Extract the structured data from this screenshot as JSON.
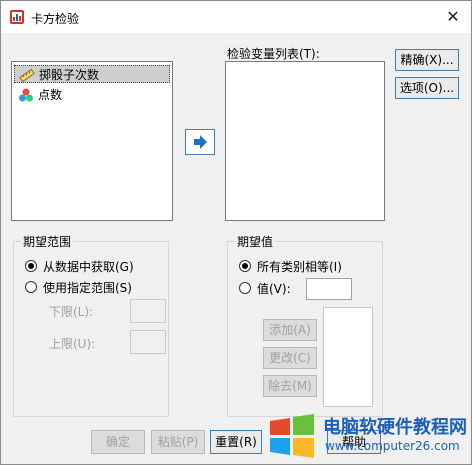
{
  "window": {
    "title": "卡方检验",
    "close_glyph": "✕"
  },
  "source_list": {
    "items": [
      {
        "label": "掷骰子次数",
        "icon": "ruler-icon",
        "selected": true
      },
      {
        "label": "点数",
        "icon": "nominal-icon",
        "selected": false
      }
    ]
  },
  "test_var_list": {
    "label": "检验变量列表(T):"
  },
  "side_buttons": {
    "exact": "精确(X)...",
    "options": "选项(O)..."
  },
  "expected_range": {
    "title": "期望范围",
    "from_data": "从数据中获取(G)",
    "use_range": "使用指定范围(S)",
    "lower": "下限(L):",
    "upper": "上限(U):"
  },
  "expected_values": {
    "title": "期望值",
    "all_equal": "所有类别相等(I)",
    "values": "值(V):",
    "add": "添加(A)",
    "change": "更改(C)",
    "remove": "除去(M)"
  },
  "bottom_buttons": {
    "ok": "确定",
    "paste": "粘贴(P)",
    "reset": "重置(R)",
    "help": "帮助"
  },
  "watermark": {
    "line1": "电脑软硬件教程网",
    "line2": "www.computer26.com"
  },
  "colors": {
    "accent": "#3c7fb1",
    "selection": "#cfcfcf"
  }
}
